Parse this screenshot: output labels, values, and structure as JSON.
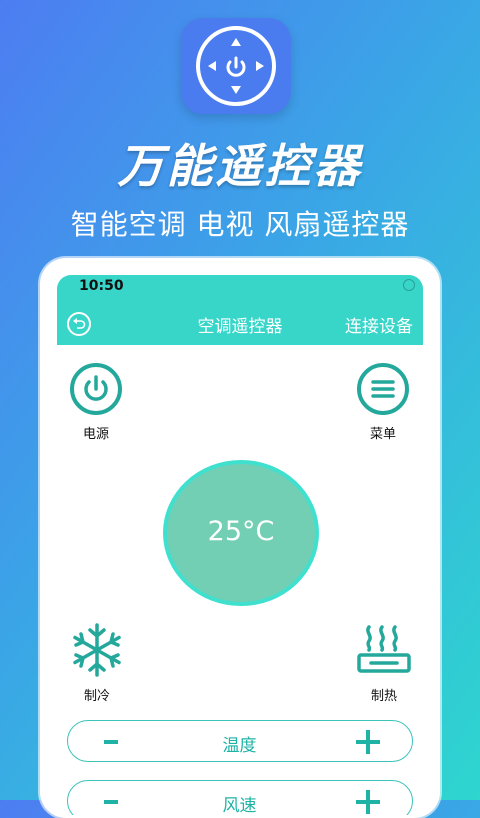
{
  "promo": {
    "headline": "万能遥控器",
    "subline": "智能空调 电视 风扇遥控器"
  },
  "status_bar": {
    "time": "10:50"
  },
  "app_bar": {
    "title": "空调遥控器",
    "connect_label": "连接设备"
  },
  "controls": {
    "power_label": "电源",
    "menu_label": "菜单",
    "temperature_display": "25°C",
    "cool_label": "制冷",
    "heat_label": "制热"
  },
  "adjusters": [
    {
      "label": "温度"
    },
    {
      "label": "风速"
    }
  ],
  "colors": {
    "accent": "#37d6c9",
    "button_ring": "#24a89c",
    "temp_fill": "#72cfb4",
    "pill_text": "#1fb3a6"
  },
  "icons": {
    "app_icon": "remote-dpad-power-icon",
    "back": "back-arrow-icon",
    "power": "power-icon",
    "menu": "menu-icon",
    "cool": "snowflake-icon",
    "heat": "heat-icon",
    "minus": "minus-icon",
    "plus": "plus-icon"
  }
}
